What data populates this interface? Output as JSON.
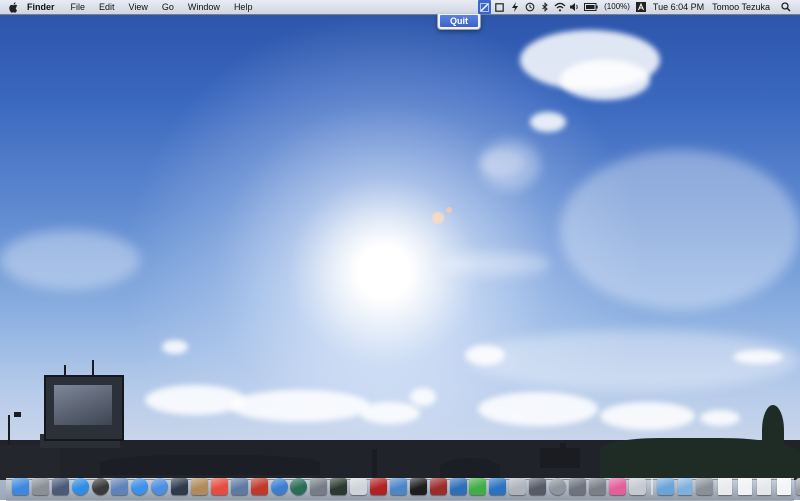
{
  "menubar": {
    "apple_icon": "apple-logo-icon",
    "app_name": "Finder",
    "menus": [
      "File",
      "Edit",
      "View",
      "Go",
      "Window",
      "Help"
    ],
    "status": {
      "icons": [
        "app-switcher-icon",
        "window-icon",
        "flash-icon",
        "time-machine-icon",
        "bluetooth-icon",
        "wifi-icon",
        "volume-icon",
        "battery-icon"
      ],
      "battery_text": "(100%)",
      "input_icon": "text-input-icon",
      "clock": "Tue 6:04 PM",
      "user": "Tomoo Tezuka",
      "search_icon": "spotlight-search-icon"
    }
  },
  "dropdown": {
    "items": [
      "Quit"
    ]
  },
  "dock": {
    "apps": [
      {
        "name": "finder",
        "color": "#3e88e0"
      },
      {
        "name": "launchpad",
        "color": "#8a8f98"
      },
      {
        "name": "mission-control",
        "color": "#4a5a78"
      },
      {
        "name": "app-store",
        "color": "#2e8de4"
      },
      {
        "name": "dashboard",
        "color": "#3a3a3a"
      },
      {
        "name": "preview",
        "color": "#5d83b8"
      },
      {
        "name": "safari",
        "color": "#3b90e8"
      },
      {
        "name": "ichat",
        "color": "#4c8fe0"
      },
      {
        "name": "facetime",
        "color": "#2f3a4c"
      },
      {
        "name": "address-book",
        "color": "#b08a5a"
      },
      {
        "name": "ical",
        "color": "#e44d3f"
      },
      {
        "name": "iphoto",
        "color": "#5f7aa0"
      },
      {
        "name": "photo-booth",
        "color": "#c0392b"
      },
      {
        "name": "itunes",
        "color": "#3c7fd0"
      },
      {
        "name": "time-machine",
        "color": "#2b6e57"
      },
      {
        "name": "system-preferences",
        "color": "#777d86"
      },
      {
        "name": "activity-monitor",
        "color": "#2b3a30"
      },
      {
        "name": "textedit",
        "color": "#d0d4da"
      },
      {
        "name": "adobe-acrobat",
        "color": "#b22222"
      },
      {
        "name": "xcode",
        "color": "#4a86c8"
      },
      {
        "name": "terminal",
        "color": "#1e1e1e"
      },
      {
        "name": "dictionary",
        "color": "#9c2b2b"
      },
      {
        "name": "illustrator",
        "color": "#2e6fb8"
      },
      {
        "name": "evernote",
        "color": "#3fae45"
      },
      {
        "name": "photoshop",
        "color": "#2a73c0"
      },
      {
        "name": "notes",
        "color": "#b0b4ba"
      },
      {
        "name": "network-utility",
        "color": "#565c66"
      },
      {
        "name": "disk-utility",
        "color": "#8f959e"
      },
      {
        "name": "stickies",
        "color": "#6e747d"
      },
      {
        "name": "automator",
        "color": "#7b8088"
      },
      {
        "name": "font-book",
        "color": "#e35f9c"
      },
      {
        "name": "script-editor",
        "color": "#c5cad2"
      }
    ],
    "folders": [
      {
        "name": "applications-folder",
        "color": "#6aa4d8"
      },
      {
        "name": "documents-folder",
        "color": "#7fb1e0"
      },
      {
        "name": "downloads-stack",
        "color": "#8a9098"
      },
      {
        "name": "document-stack-1",
        "color": "#e8eaee"
      },
      {
        "name": "document-stack-2",
        "color": "#f0f2f5"
      },
      {
        "name": "document-stack-3",
        "color": "#e4e7ec"
      },
      {
        "name": "document-stack-4",
        "color": "#f3f4f6"
      },
      {
        "name": "trash",
        "color": "#9aa0a8"
      }
    ]
  }
}
